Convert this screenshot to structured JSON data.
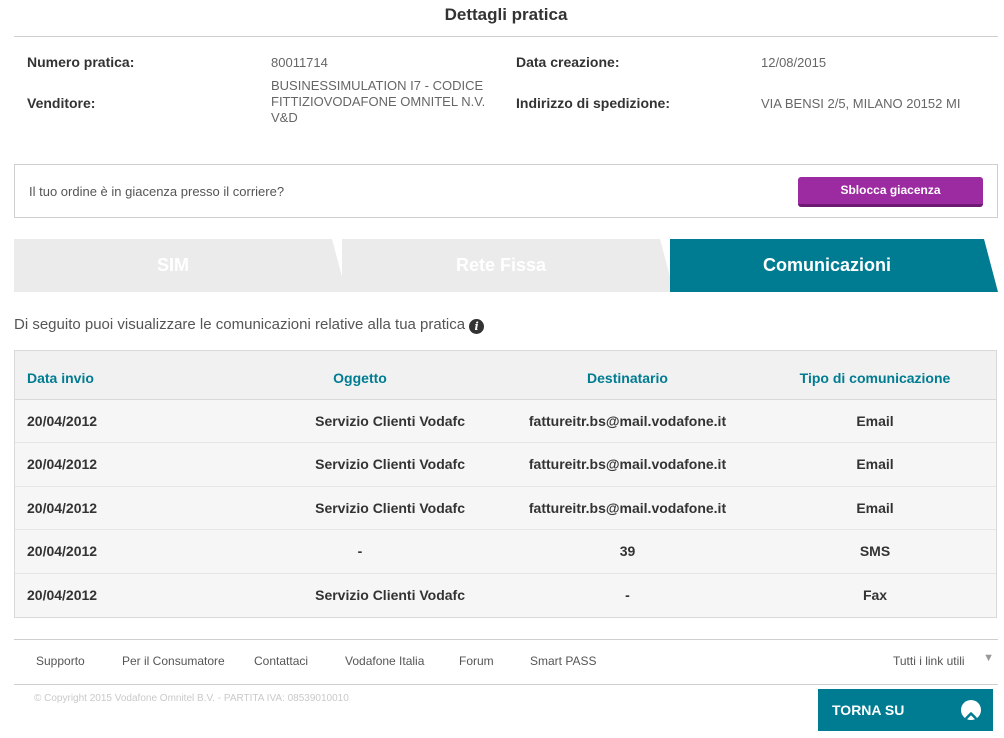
{
  "page": {
    "title": "Dettagli pratica"
  },
  "info": {
    "numero_label": "Numero pratica:",
    "numero_value": "80011714",
    "venditore_label": "Venditore:",
    "venditore_value": "BUSINESSIMULATION I7 - CODICE FITTIZIOVODAFONE OMNITEL N.V. V&D",
    "data_label": "Data creazione:",
    "data_value": "12/08/2015",
    "indirizzo_label": "Indirizzo di spedizione:",
    "indirizzo_value": "VIA BENSI 2/5, MILANO 20152 MI"
  },
  "glacenza": {
    "question": "Il tuo ordine è in giacenza presso il corriere?",
    "button": "Sblocca giacenza"
  },
  "tabs": [
    {
      "label": "SIM",
      "active": false
    },
    {
      "label": "Rete Fissa",
      "active": false
    },
    {
      "label": "Comunicazioni",
      "active": true
    }
  ],
  "subtitle": "Di seguito puoi visualizzare le comunicazioni relative alla tua pratica",
  "table": {
    "headers": [
      "Data invio",
      "Oggetto",
      "Destinatario",
      "Tipo di comunicazione"
    ],
    "rows": [
      [
        "20/04/2012",
        "Servizio Clienti Vodafc",
        "fattureitr.bs@mail.vodafone.it",
        "Email"
      ],
      [
        "20/04/2012",
        "Servizio Clienti Vodafc",
        "fattureitr.bs@mail.vodafone.it",
        "Email"
      ],
      [
        "20/04/2012",
        "Servizio Clienti Vodafc",
        "fattureitr.bs@mail.vodafone.it",
        "Email"
      ],
      [
        "20/04/2012",
        "-",
        "39",
        "SMS"
      ],
      [
        "20/04/2012",
        "Servizio Clienti Vodafc",
        "-",
        "Fax"
      ]
    ]
  },
  "footer": {
    "links": [
      "Supporto",
      "Per il Consumatore",
      "Contattaci",
      "Vodafone Italia",
      "Forum",
      "Smart PASS"
    ],
    "useful_links": "Tutti i link utili",
    "copyright": "© Copyright 2015 Vodafone Omnitel B.V. - PARTITA IVA: 08539010010",
    "back_to_top": "TORNA SU"
  },
  "colors": {
    "accent": "#007c92",
    "button": "#9c2aa0",
    "tab_inactive": "#ebebeb"
  }
}
